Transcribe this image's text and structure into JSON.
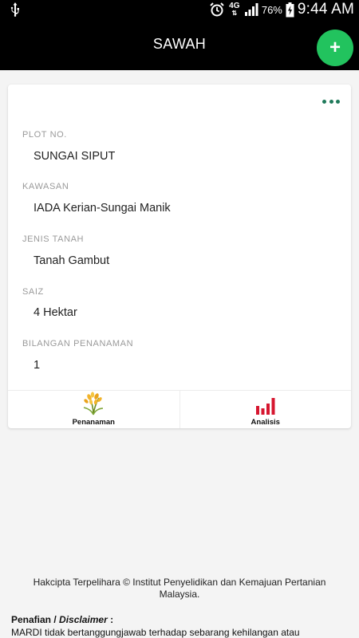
{
  "status_bar": {
    "network": "4G",
    "battery": "76%",
    "time": "9:44 AM",
    "icons": [
      "usb-icon",
      "alarm-icon",
      "signal-icon",
      "battery-charging-icon"
    ]
  },
  "app_bar": {
    "title": "SAWAH",
    "fab_icon": "+",
    "accent": "#22c35e"
  },
  "card": {
    "menu_icon": "more-horizontal-icon",
    "fields": [
      {
        "label": "PLOT NO.",
        "value": "SUNGAI SIPUT"
      },
      {
        "label": "KAWASAN",
        "value": "IADA Kerian-Sungai Manik"
      },
      {
        "label": "JENIS TANAH",
        "value": "Tanah Gambut"
      },
      {
        "label": "SAIZ",
        "value": "4 Hektar"
      },
      {
        "label": "BILANGAN PENANAMAN",
        "value": "1"
      }
    ],
    "actions": [
      {
        "label": "Penanaman",
        "icon": "rice-plant-icon"
      },
      {
        "label": "Analisis",
        "icon": "bar-chart-icon"
      }
    ]
  },
  "footer": {
    "copyright": "Hakcipta Terpelihara © Institut Penyelidikan dan Kemajuan Pertanian Malaysia.",
    "disclaimer_title_prefix": "Penafian / ",
    "disclaimer_title_en": "Disclaimer",
    "disclaimer_title_suffix": " :",
    "disclaimer_text": "MARDI tidak bertanggungjawab terhadap sebarang kehilangan atau"
  }
}
